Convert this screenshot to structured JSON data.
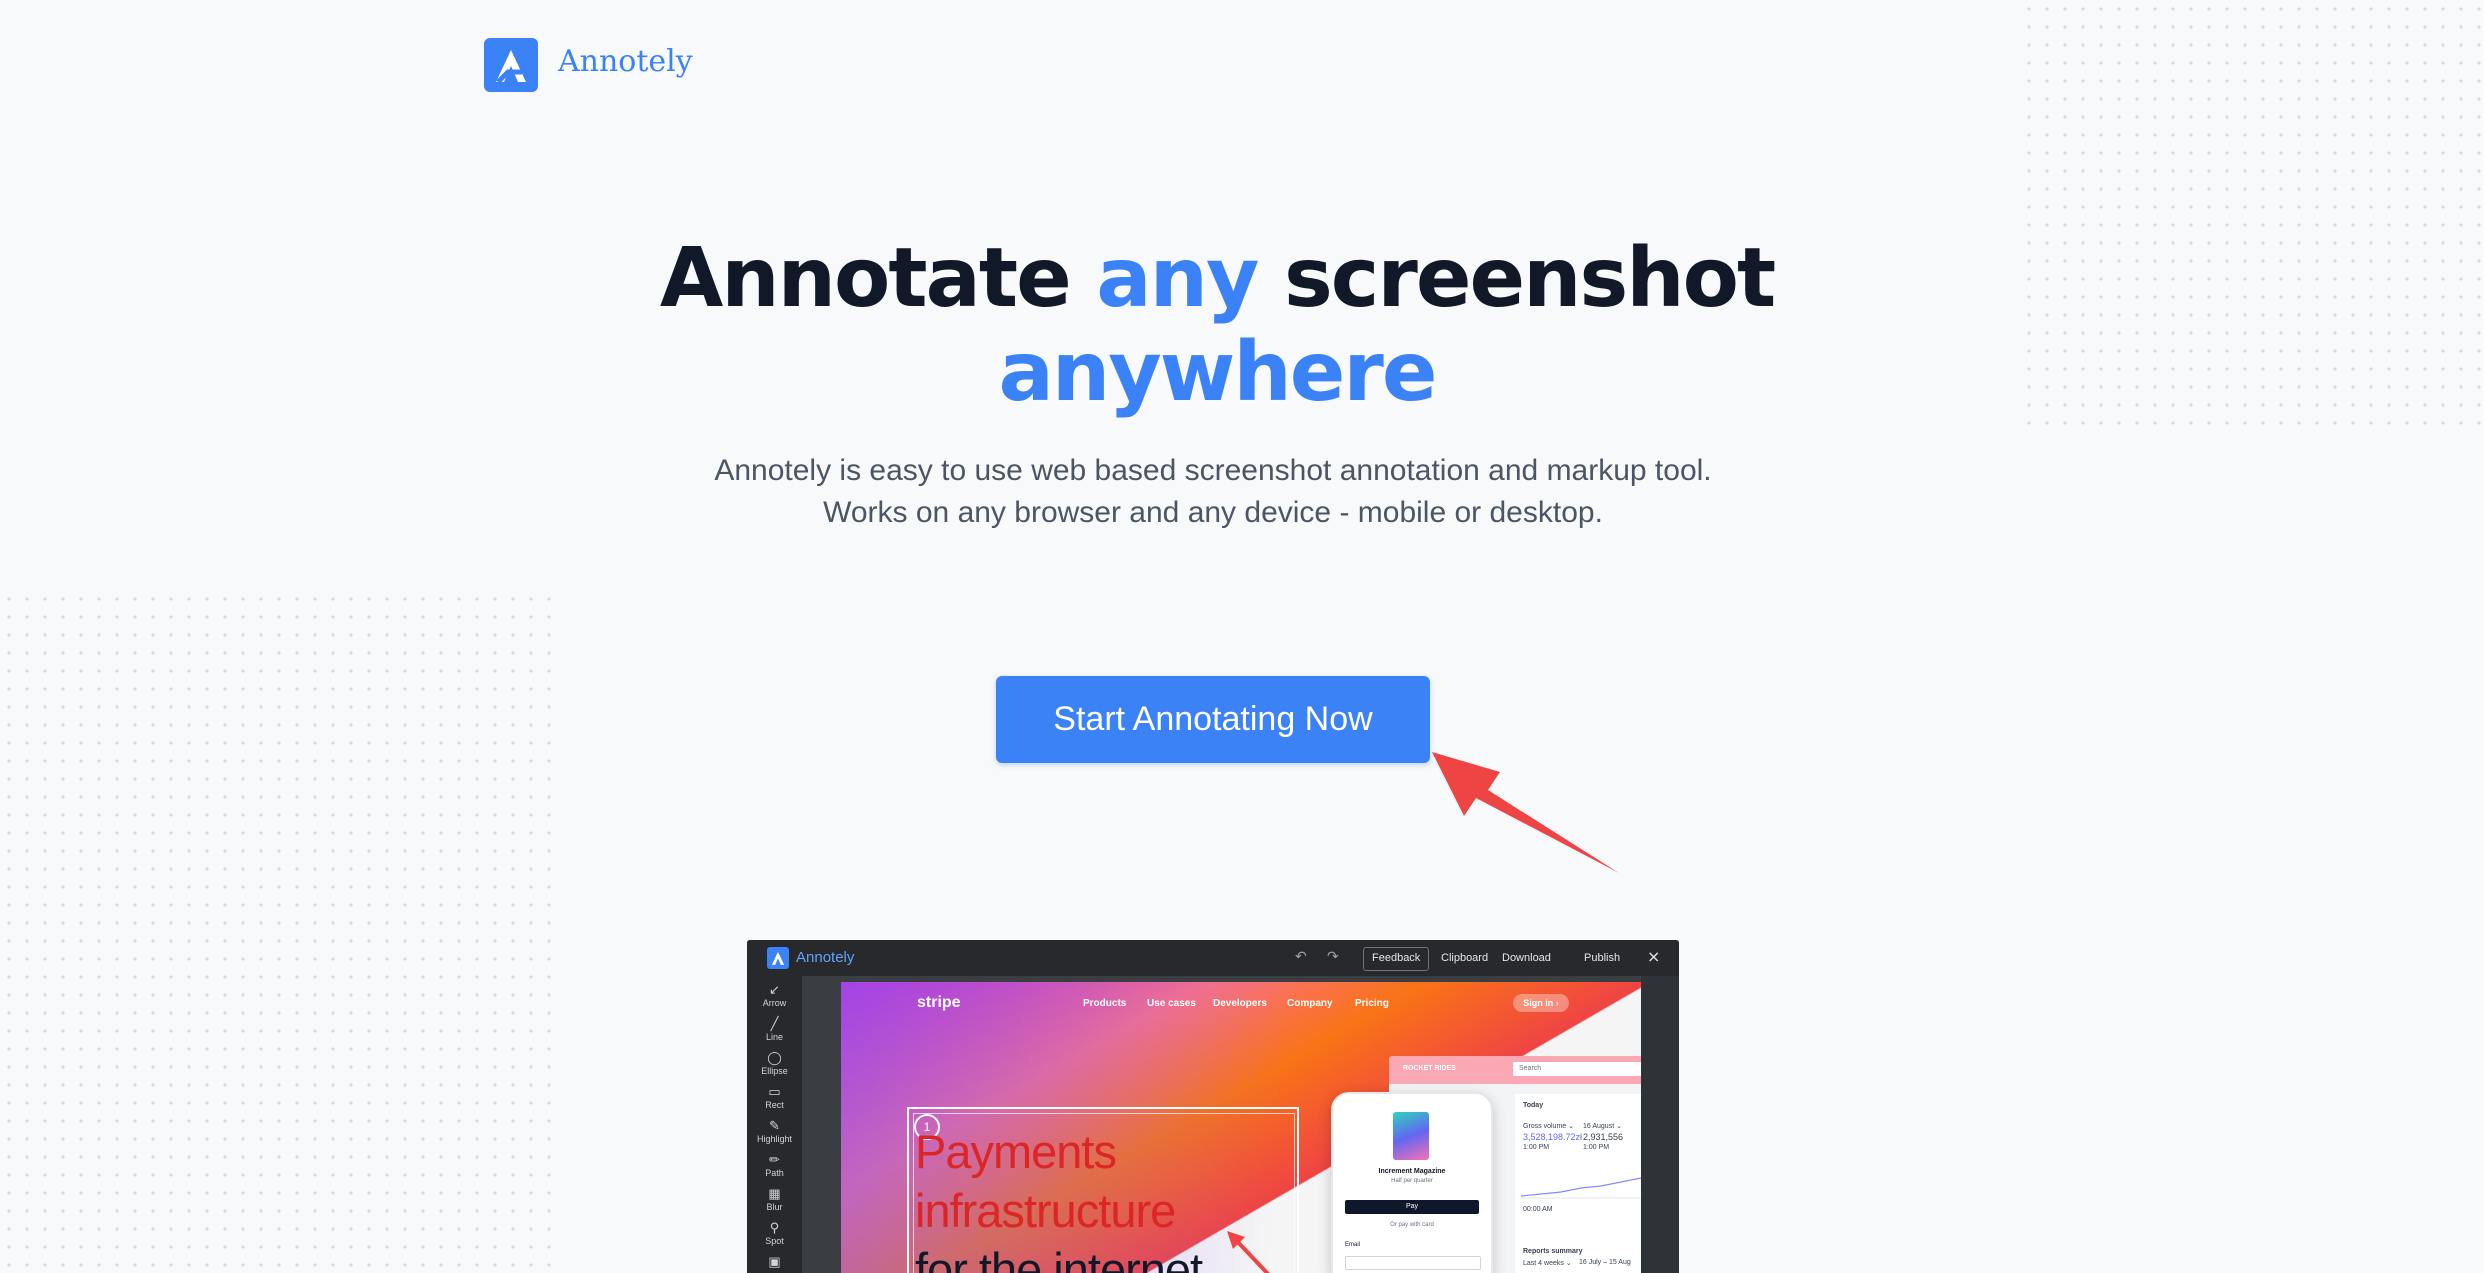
{
  "header": {
    "brand": "Annotely",
    "logo_icon": "annotely-logo-icon"
  },
  "hero": {
    "title_part1": "Annotate ",
    "title_highlight1": "any",
    "title_part2": " screenshot",
    "title_highlight2": "anywhere",
    "subtitle_line1": "Annotely is easy to use web based screenshot annotation and markup tool.",
    "subtitle_line2": "Works on any browser and any device - mobile or desktop.",
    "cta_label": "Start Annotating Now"
  },
  "colors": {
    "accent": "#3b82f6",
    "heading": "#111827",
    "body_text": "#4b5563",
    "annotation_red": "#ef4444",
    "background": "#f8f9fb"
  },
  "app_preview": {
    "brand": "Annotely",
    "toolbar": {
      "undo_icon": "undo-icon",
      "redo_icon": "redo-icon",
      "feedback": "Feedback",
      "clipboard": "Clipboard",
      "download": "Download",
      "publish": "Publish",
      "close": "×"
    },
    "tools": [
      {
        "label": "Arrow",
        "icon": "arrow-tool-icon",
        "glyph": "↙"
      },
      {
        "label": "Line",
        "icon": "line-tool-icon",
        "glyph": "╱"
      },
      {
        "label": "Ellipse",
        "icon": "ellipse-tool-icon",
        "glyph": "◯"
      },
      {
        "label": "Rect",
        "icon": "rect-tool-icon",
        "glyph": "▭"
      },
      {
        "label": "Highlight",
        "icon": "highlight-tool-icon",
        "glyph": "✎"
      },
      {
        "label": "Path",
        "icon": "path-tool-icon",
        "glyph": "✏"
      },
      {
        "label": "Blur",
        "icon": "blur-tool-icon",
        "glyph": "▦"
      },
      {
        "label": "Spot",
        "icon": "spot-tool-icon",
        "glyph": "⚲"
      },
      {
        "label": "",
        "icon": "image-tool-icon",
        "glyph": "▣"
      }
    ],
    "screenshot": {
      "logo": "stripe",
      "nav": [
        "Products",
        "Use cases",
        "Developers",
        "Company",
        "Pricing"
      ],
      "sign_in": "Sign in ›",
      "headline_lines": [
        "Payments",
        "infrastructure",
        "for the internet"
      ],
      "marker_number": "1",
      "dashboard": {
        "company": "ROCKET RIDES",
        "search": "Search",
        "today": "Today",
        "gross_volume_label": "Gross volume ⌄",
        "gross_volume": "3,528,198.72zł",
        "gross_time": "1:00 PM",
        "compare_label": "16 August ⌄",
        "compare_value": "2,931,556",
        "compare_time": "1:00 PM",
        "time_start": "00:00 AM",
        "reports_summary": "Reports summary",
        "range": "Last 4 weeks ⌄",
        "range_dates": "16 July – 15 Aug"
      },
      "phone": {
        "product": "Increment Magazine",
        "price": "Half per quarter",
        "pay": " Pay",
        "or_pay": "Or pay with card",
        "email": "Email"
      }
    }
  }
}
